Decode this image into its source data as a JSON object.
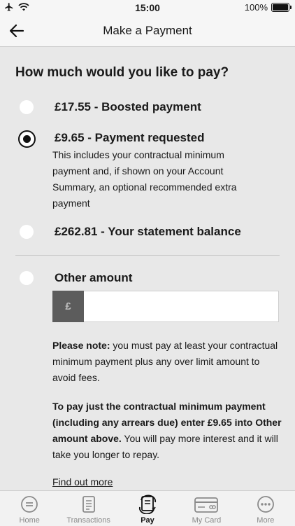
{
  "status_bar": {
    "time": "15:00",
    "battery": "100%"
  },
  "nav": {
    "title": "Make a Payment"
  },
  "question": "How much would you like to pay?",
  "options": [
    {
      "label": "£17.55 - Boosted payment",
      "selected": false
    },
    {
      "label": "£9.65 - Payment requested",
      "selected": true,
      "description": "This includes your contractual minimum payment and, if shown on your Account Summary, an optional recommended extra payment"
    },
    {
      "label": "£262.81 - Your statement balance",
      "selected": false
    },
    {
      "label": "Other amount",
      "selected": false
    }
  ],
  "other_amount": {
    "currency_symbol": "£",
    "value": "",
    "placeholder": ""
  },
  "note": {
    "bold": "Please note:",
    "text": " you must pay at least your contractual minimum payment plus any over limit amount to avoid fees."
  },
  "min_payment_info": {
    "bold": "To pay just the contractual minimum payment (including any arrears due) enter £9.65 into Other amount above.",
    "text": " You will pay more interest and it will take you longer to repay."
  },
  "find_out_more": "Find out more",
  "tabs": [
    {
      "label": "Home",
      "icon": "home-icon"
    },
    {
      "label": "Transactions",
      "icon": "transactions-icon"
    },
    {
      "label": "Pay",
      "icon": "pay-icon",
      "active": true
    },
    {
      "label": "My Card",
      "icon": "card-icon"
    },
    {
      "label": "More",
      "icon": "more-icon"
    }
  ]
}
